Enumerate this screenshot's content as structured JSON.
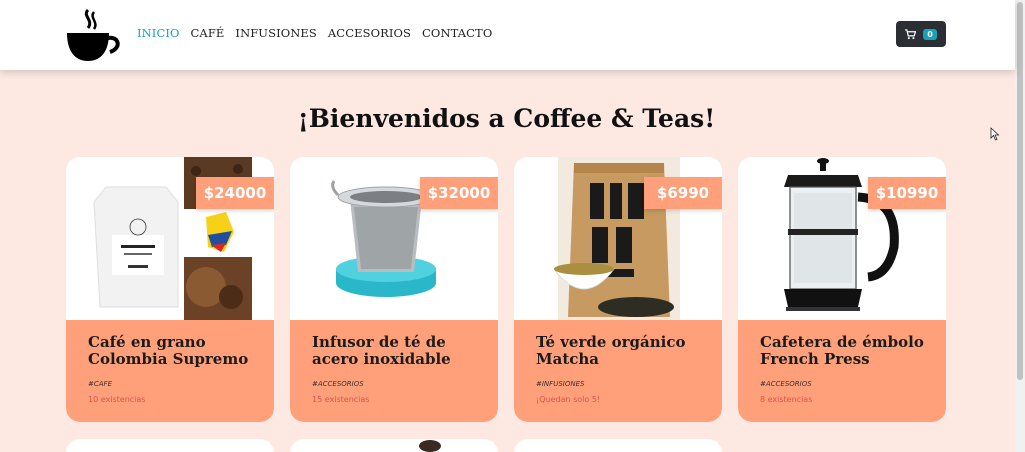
{
  "nav": {
    "logo_icon": "coffee-cup-icon",
    "links": [
      {
        "label": "INICIO",
        "active": true
      },
      {
        "label": "CAFÉ",
        "active": false
      },
      {
        "label": "INFUSIONES",
        "active": false
      },
      {
        "label": "ACCESORIOS",
        "active": false
      },
      {
        "label": "CONTACTO",
        "active": false
      }
    ],
    "cart": {
      "icon": "cart-icon",
      "count": "0"
    }
  },
  "main": {
    "title": "¡Bienvenidos a Coffee & Teas!",
    "products": [
      {
        "title": "Café en grano Colombia Supremo",
        "price": "$24000",
        "tag": "#CAFE",
        "stock": "10 existencias"
      },
      {
        "title": "Infusor de té de acero inoxidable",
        "price": "$32000",
        "tag": "#ACCESORIOS",
        "stock": "15 existencias"
      },
      {
        "title": "Té verde orgánico Matcha",
        "price": "$6990",
        "tag": "#INFUSIONES",
        "stock": "¡Quedan solo 5!"
      },
      {
        "title": "Cafetera de émbolo French Press",
        "price": "$10990",
        "tag": "#ACCESORIOS",
        "stock": "8 existencias"
      }
    ]
  },
  "colors": {
    "accent": "#17a2b8",
    "card_body": "#ffa07a",
    "background": "#fde9e2",
    "stock_text": "#d9534f"
  }
}
